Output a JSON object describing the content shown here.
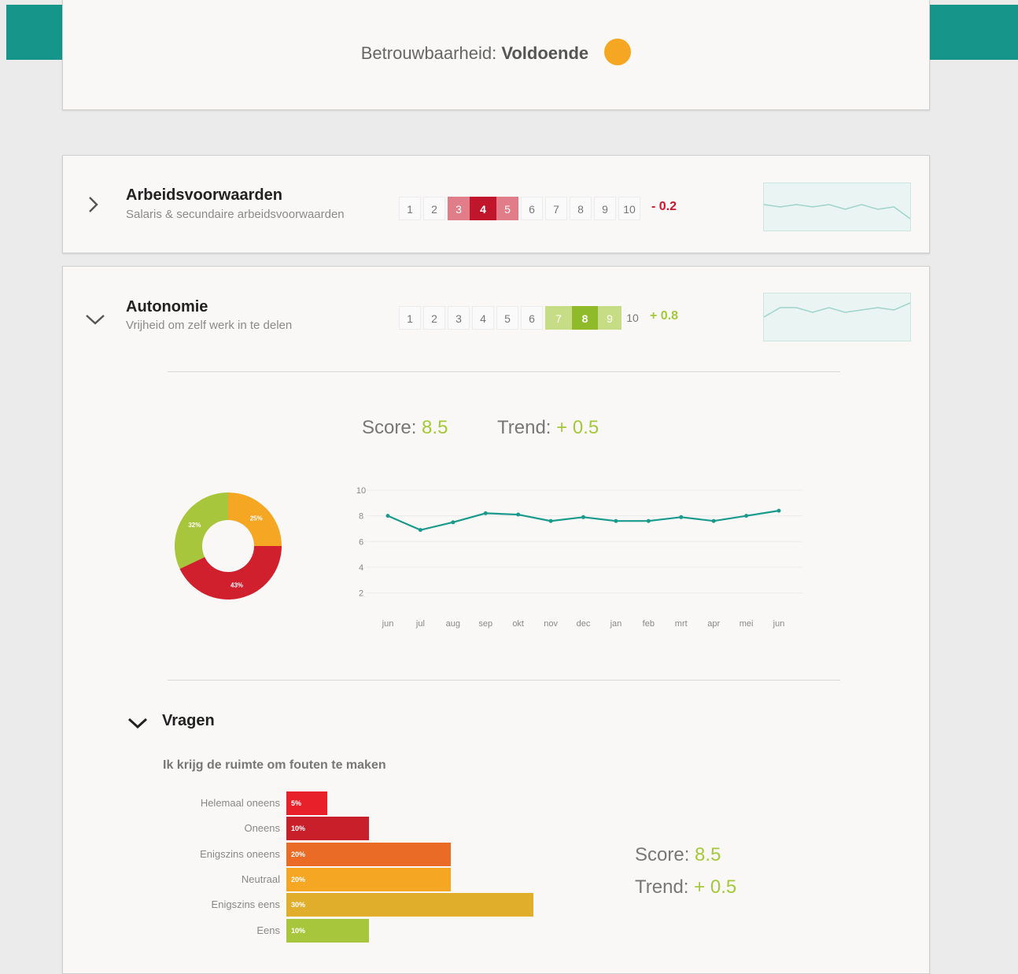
{
  "reliability": {
    "label": "Betrouwbaarheid:",
    "value": "Voldoende",
    "status_color": "#f5a623"
  },
  "categories": [
    {
      "title": "Arbeidsvoorwaarden",
      "subtitle": "Salaris & secundaire arbeidsvoorwaarden",
      "scale": [
        "1",
        "2",
        "3",
        "4",
        "5",
        "6",
        "7",
        "8",
        "9",
        "10"
      ],
      "selected": "4",
      "delta": "- 0.2",
      "expanded": false
    },
    {
      "title": "Autonomie",
      "subtitle": "Vrijheid om zelf werk in te delen",
      "scale": [
        "1",
        "2",
        "3",
        "4",
        "5",
        "6",
        "7",
        "8",
        "9",
        "10"
      ],
      "selected": "8",
      "delta": "+ 0.8",
      "expanded": true
    }
  ],
  "summary": {
    "score_label": "Score:",
    "score_value": "8.5",
    "trend_label": "Trend:",
    "trend_value": "+ 0.5"
  },
  "vragen": {
    "title": "Vragen",
    "question": "Ik krijg de ruimte om fouten te maken",
    "score_label": "Score:",
    "score_value": "8.5",
    "trend_label": "Trend:",
    "trend_value": "+ 0.5"
  },
  "chart_data": [
    {
      "type": "pie",
      "slices": [
        {
          "label": "25%",
          "value": 25,
          "color": "#f5a623"
        },
        {
          "label": "43%",
          "value": 43,
          "color": "#d0202e"
        },
        {
          "label": "32%",
          "value": 32,
          "color": "#a8c63c"
        }
      ]
    },
    {
      "type": "line",
      "categories": [
        "jun",
        "jul",
        "aug",
        "sep",
        "okt",
        "nov",
        "dec",
        "jan",
        "feb",
        "mrt",
        "apr",
        "mei",
        "jun"
      ],
      "values": [
        8.0,
        6.9,
        7.5,
        8.2,
        8.1,
        7.6,
        7.9,
        7.6,
        7.6,
        7.9,
        7.6,
        8.0,
        8.4
      ],
      "yticks": [
        "10",
        "8",
        "6",
        "4",
        "2"
      ],
      "ylim": [
        1,
        10
      ],
      "color": "#1a9a8c",
      "grid": true
    },
    {
      "type": "bar",
      "categories": [
        "Helemaal oneens",
        "Oneens",
        "Enigszins oneens",
        "Neutraal",
        "Enigszins eens",
        "Eens"
      ],
      "values": [
        5,
        10,
        20,
        20,
        30,
        10
      ],
      "labels": [
        "5%",
        "10%",
        "20%",
        "20%",
        "30%",
        "10%"
      ],
      "colors": [
        "#e8202a",
        "#c81f2a",
        "#e96b25",
        "#f5a623",
        "#e0ae2a",
        "#a8c63c"
      ]
    }
  ],
  "sparklines": [
    {
      "values": [
        0.45,
        0.5,
        0.45,
        0.5,
        0.45,
        0.55,
        0.45,
        0.55,
        0.5,
        0.75
      ]
    },
    {
      "values": [
        0.5,
        0.3,
        0.3,
        0.4,
        0.3,
        0.4,
        0.35,
        0.3,
        0.35,
        0.2
      ]
    }
  ]
}
